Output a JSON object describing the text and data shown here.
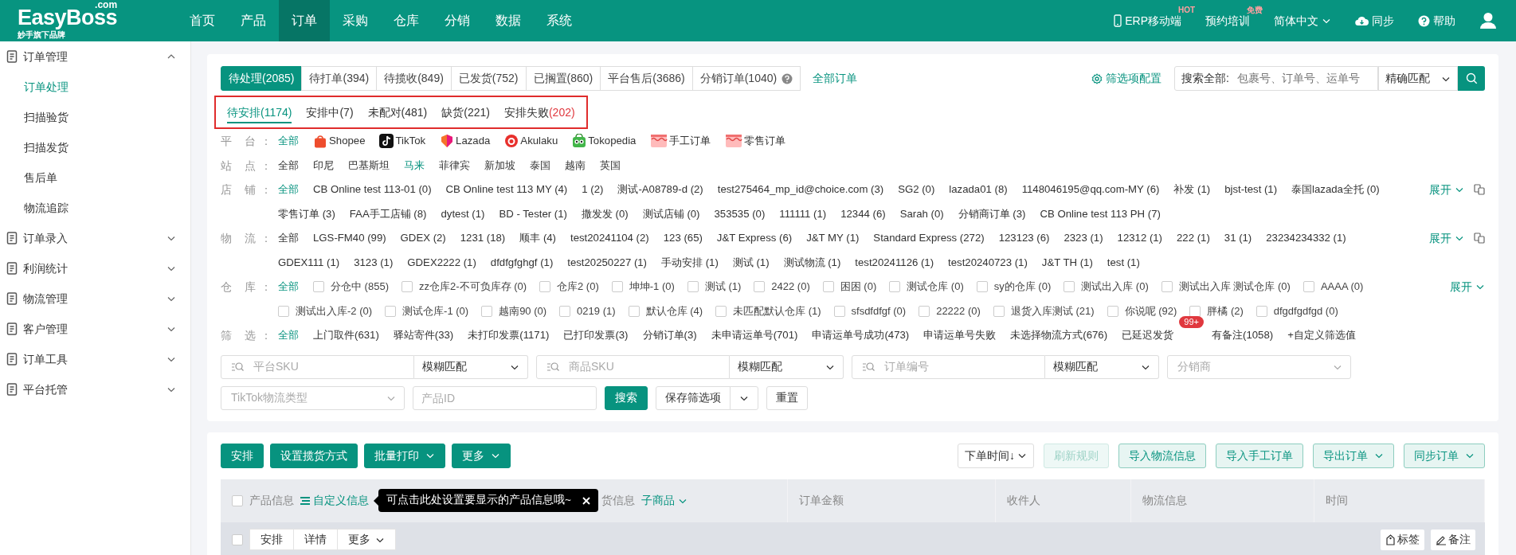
{
  "header": {
    "logo": "EasyBoss",
    "logo_suffix": ".com",
    "tagline": "妙手旗下品牌",
    "nav": [
      {
        "label": "首页",
        "selected": false
      },
      {
        "label": "产品",
        "selected": false
      },
      {
        "label": "订单",
        "selected": true
      },
      {
        "label": "采购",
        "selected": false
      },
      {
        "label": "仓库",
        "selected": false
      },
      {
        "label": "分销",
        "selected": false
      },
      {
        "label": "数据",
        "selected": false
      },
      {
        "label": "系统",
        "selected": false
      }
    ],
    "tools": [
      {
        "kind": "mobile",
        "label": "ERP移动端",
        "badge": "HOT"
      },
      {
        "kind": "plain",
        "label": "预约培训",
        "badge": "免费"
      },
      {
        "kind": "language",
        "label": "简体中文"
      },
      {
        "kind": "sync",
        "label": "同步"
      },
      {
        "kind": "help",
        "label": "帮助"
      },
      {
        "kind": "user"
      }
    ]
  },
  "sidebar": [
    {
      "label": "订单管理",
      "expanded": true,
      "children": [
        {
          "label": "订单处理",
          "selected": true
        },
        {
          "label": "扫描验货",
          "selected": false
        },
        {
          "label": "扫描发货",
          "selected": false
        },
        {
          "label": "售后单",
          "selected": false
        },
        {
          "label": "物流追踪",
          "selected": false
        }
      ]
    },
    {
      "label": "订单录入",
      "expanded": false
    },
    {
      "label": "利润统计",
      "expanded": false
    },
    {
      "label": "物流管理",
      "expanded": false
    },
    {
      "label": "客户管理",
      "expanded": false
    },
    {
      "label": "订单工具",
      "expanded": false
    },
    {
      "label": "平台托管",
      "expanded": false
    }
  ],
  "status_tabs": [
    {
      "label": "待处理(2085)",
      "selected": true,
      "help": false
    },
    {
      "label": "待打单(394)",
      "selected": false,
      "help": false
    },
    {
      "label": "待揽收(849)",
      "selected": false,
      "help": false
    },
    {
      "label": "已发货(752)",
      "selected": false,
      "help": false
    },
    {
      "label": "已搁置(860)",
      "selected": false,
      "help": false
    },
    {
      "label": "平台售后(3686)",
      "selected": false,
      "help": false
    },
    {
      "label": "分销订单(1040)",
      "selected": false,
      "help": true
    }
  ],
  "all_orders_link": "全部订单",
  "filter_config": "筛选项配置",
  "global_search": {
    "label": "搜索全部:",
    "placeholder": "包裹号、订单号、运单号",
    "match": "精确匹配"
  },
  "sub_tabs": [
    {
      "label": "待安排",
      "count": "(1174)",
      "selected": true,
      "alert": false
    },
    {
      "label": "安排中",
      "count": "(7)",
      "selected": false,
      "alert": false
    },
    {
      "label": "未配对",
      "count": "(481)",
      "selected": false,
      "alert": false
    },
    {
      "label": "缺货",
      "count": "(221)",
      "selected": false,
      "alert": false
    },
    {
      "label": "安排失败",
      "count": "(202)",
      "selected": false,
      "alert": true
    }
  ],
  "filters": [
    {
      "label": "平 台：",
      "items": [
        {
          "kind": "link",
          "label": "全部",
          "selected": true
        },
        {
          "kind": "platform",
          "label": "Shopee",
          "selected": false
        },
        {
          "kind": "platform",
          "label": "TikTok",
          "selected": false
        },
        {
          "kind": "platform",
          "label": "Lazada",
          "selected": false
        },
        {
          "kind": "platform",
          "label": "Akulaku",
          "selected": false
        },
        {
          "kind": "platform",
          "label": "Tokopedia",
          "selected": false
        },
        {
          "kind": "platform",
          "label": "手工订单",
          "selected": false
        },
        {
          "kind": "platform",
          "label": "零售订单",
          "selected": false
        }
      ]
    },
    {
      "label": "站 点：",
      "items": [
        {
          "kind": "link",
          "label": "全部",
          "selected": false
        },
        {
          "kind": "link",
          "label": "印尼",
          "selected": false
        },
        {
          "kind": "link",
          "label": "巴基斯坦",
          "selected": false
        },
        {
          "kind": "link",
          "label": "马来",
          "selected": true
        },
        {
          "kind": "link",
          "label": "菲律宾",
          "selected": false
        },
        {
          "kind": "link",
          "label": "新加坡",
          "selected": false
        },
        {
          "kind": "link",
          "label": "泰国",
          "selected": false
        },
        {
          "kind": "link",
          "label": "越南",
          "selected": false
        },
        {
          "kind": "link",
          "label": "英国",
          "selected": false
        }
      ]
    },
    {
      "label": "店 铺：",
      "expand": "展开",
      "copy_icon": true,
      "items": [
        {
          "kind": "link",
          "label": "全部",
          "selected": true
        },
        {
          "kind": "link",
          "label": "CB Online test 113-01 (0)",
          "selected": false
        },
        {
          "kind": "link",
          "label": "CB Online test 113 MY (4)",
          "selected": false
        },
        {
          "kind": "link",
          "label": "1 (2)",
          "selected": false
        },
        {
          "kind": "link",
          "label": "测试-A08789-d (2)",
          "selected": false
        },
        {
          "kind": "link",
          "label": "test275464_mp_id@choice.com (3)",
          "selected": false
        },
        {
          "kind": "link",
          "label": "SG2 (0)",
          "selected": false
        },
        {
          "kind": "link",
          "label": "lazada01 (8)",
          "selected": false
        },
        {
          "kind": "link",
          "label": "1148046195@qq.com-MY (6)",
          "selected": false
        },
        {
          "kind": "link",
          "label": "补发 (1)",
          "selected": false
        },
        {
          "kind": "link",
          "label": "bjst-test (1)",
          "selected": false
        },
        {
          "kind": "link",
          "label": "泰国lazada全托 (0)",
          "selected": false
        },
        {
          "kind": "link",
          "label": "零售订单 (3)",
          "selected": false
        },
        {
          "kind": "link",
          "label": "FAA手工店铺 (8)",
          "selected": false
        },
        {
          "kind": "link",
          "label": "dytest (1)",
          "selected": false
        },
        {
          "kind": "link",
          "label": "BD - Tester (1)",
          "selected": false
        },
        {
          "kind": "link",
          "label": "撒发发 (0)",
          "selected": false
        },
        {
          "kind": "link",
          "label": "测试店铺 (0)",
          "selected": false
        },
        {
          "kind": "link",
          "label": "353535 (0)",
          "selected": false
        },
        {
          "kind": "link",
          "label": "111111 (1)",
          "selected": false
        },
        {
          "kind": "link",
          "label": "12344 (6)",
          "selected": false
        },
        {
          "kind": "link",
          "label": "Sarah (0)",
          "selected": false
        },
        {
          "kind": "link",
          "label": "分销商订单 (3)",
          "selected": false
        },
        {
          "kind": "link",
          "label": "CB Online test 113 PH (7)",
          "selected": false
        }
      ]
    },
    {
      "label": "物 流：",
      "expand": "展开",
      "copy_icon": true,
      "items": [
        {
          "kind": "link",
          "label": "全部",
          "selected": false
        },
        {
          "kind": "link",
          "label": "LGS-FM40 (99)",
          "selected": false
        },
        {
          "kind": "link",
          "label": "GDEX (2)",
          "selected": false
        },
        {
          "kind": "link",
          "label": "1231 (18)",
          "selected": false
        },
        {
          "kind": "link",
          "label": "顺丰 (4)",
          "selected": false
        },
        {
          "kind": "link",
          "label": "test20241104 (2)",
          "selected": false
        },
        {
          "kind": "link",
          "label": "123 (65)",
          "selected": false
        },
        {
          "kind": "link",
          "label": "J&T Express (6)",
          "selected": false
        },
        {
          "kind": "link",
          "label": "J&T MY (1)",
          "selected": false
        },
        {
          "kind": "link",
          "label": "Standard Express (272)",
          "selected": false
        },
        {
          "kind": "link",
          "label": "123123 (6)",
          "selected": false
        },
        {
          "kind": "link",
          "label": "2323 (1)",
          "selected": false
        },
        {
          "kind": "link",
          "label": "12312 (1)",
          "selected": false
        },
        {
          "kind": "link",
          "label": "222 (1)",
          "selected": false
        },
        {
          "kind": "link",
          "label": "31 (1)",
          "selected": false
        },
        {
          "kind": "link",
          "label": "23234234332 (1)",
          "selected": false
        },
        {
          "kind": "link",
          "label": "GDEX111 (1)",
          "selected": false
        },
        {
          "kind": "link",
          "label": "3123 (1)",
          "selected": false
        },
        {
          "kind": "link",
          "label": "GDEX2222 (1)",
          "selected": false
        },
        {
          "kind": "link",
          "label": "dfdfgfghgf (1)",
          "selected": false
        },
        {
          "kind": "link",
          "label": "test20250227 (1)",
          "selected": false
        },
        {
          "kind": "link",
          "label": "手动安排 (1)",
          "selected": false
        },
        {
          "kind": "link",
          "label": "测试 (1)",
          "selected": false
        },
        {
          "kind": "link",
          "label": "测试物流 (1)",
          "selected": false
        },
        {
          "kind": "link",
          "label": "test20241126 (1)",
          "selected": false
        },
        {
          "kind": "link",
          "label": "test20240723 (1)",
          "selected": false
        },
        {
          "kind": "link",
          "label": "J&T TH (1)",
          "selected": false
        },
        {
          "kind": "link",
          "label": "test (1)",
          "selected": false
        }
      ]
    },
    {
      "label": "仓 库：",
      "expand": "展开",
      "copy_icon": false,
      "items": [
        {
          "kind": "link",
          "label": "全部",
          "selected": true
        },
        {
          "kind": "checkbox",
          "label": "分仓中 (855)",
          "checked": false
        },
        {
          "kind": "checkbox",
          "label": "zz仓库2-不可负库存 (0)",
          "checked": false
        },
        {
          "kind": "checkbox",
          "label": "仓库2 (0)",
          "checked": false
        },
        {
          "kind": "checkbox",
          "label": "坤坤-1 (0)",
          "checked": false
        },
        {
          "kind": "checkbox",
          "label": "测试 (1)",
          "checked": false
        },
        {
          "kind": "checkbox",
          "label": "2422 (0)",
          "checked": false
        },
        {
          "kind": "checkbox",
          "label": "困困 (0)",
          "checked": false
        },
        {
          "kind": "checkbox",
          "label": "测试仓库 (0)",
          "checked": false
        },
        {
          "kind": "checkbox",
          "label": "sy的仓库 (0)",
          "checked": false
        },
        {
          "kind": "checkbox",
          "label": "测试出入库 (0)",
          "checked": false
        },
        {
          "kind": "checkbox",
          "label": "测试出入库 测试仓库 (0)",
          "checked": false
        },
        {
          "kind": "checkbox",
          "label": "AAAA (0)",
          "checked": false
        },
        {
          "kind": "checkbox",
          "label": "测试出入库-2 (0)",
          "checked": false
        },
        {
          "kind": "checkbox",
          "label": "测试仓库-1 (0)",
          "checked": false
        },
        {
          "kind": "checkbox",
          "label": "越南90 (0)",
          "checked": false
        },
        {
          "kind": "checkbox",
          "label": "0219 (1)",
          "checked": false
        },
        {
          "kind": "checkbox",
          "label": "默认仓库 (4)",
          "checked": false
        },
        {
          "kind": "checkbox",
          "label": "未匹配默认仓库 (1)",
          "checked": false
        },
        {
          "kind": "checkbox",
          "label": "sfsdfdfgf (0)",
          "checked": false
        },
        {
          "kind": "checkbox",
          "label": "22222 (0)",
          "checked": false
        },
        {
          "kind": "checkbox",
          "label": "退货入库测试 (21)",
          "checked": false
        },
        {
          "kind": "checkbox",
          "label": "你说呢 (92)",
          "checked": false
        },
        {
          "kind": "checkbox",
          "label": "胖橘 (2)",
          "checked": false
        },
        {
          "kind": "checkbox",
          "label": "dfgdfgdfgd (0)",
          "checked": false
        }
      ]
    },
    {
      "label": "筛 选：",
      "items": [
        {
          "kind": "link",
          "label": "全部",
          "selected": true
        },
        {
          "kind": "link",
          "label": "上门取件(631)",
          "selected": false
        },
        {
          "kind": "link",
          "label": "驿站寄件(33)",
          "selected": false
        },
        {
          "kind": "link",
          "label": "未打印发票(1171)",
          "selected": false
        },
        {
          "kind": "link",
          "label": "已打印发票(3)",
          "selected": false
        },
        {
          "kind": "link",
          "label": "分销订单(3)",
          "selected": false
        },
        {
          "kind": "link",
          "label": "未申请运单号(701)",
          "selected": false
        },
        {
          "kind": "link",
          "label": "申请运单号成功(473)",
          "selected": false
        },
        {
          "kind": "link",
          "label": "申请运单号失败",
          "selected": false
        },
        {
          "kind": "link",
          "label": "未选择物流方式(676)",
          "selected": false
        },
        {
          "kind": "link",
          "label": "已延迟发货",
          "selected": false,
          "badge": "99+"
        },
        {
          "kind": "link",
          "label": "有备注(1058)",
          "selected": false
        },
        {
          "kind": "action",
          "label": "+自定义筛选值"
        }
      ]
    }
  ],
  "search_rows": [
    [
      {
        "kind": "input_match",
        "placeholder": "平台SKU",
        "match": "模糊匹配"
      },
      {
        "kind": "input_match",
        "placeholder": "商品SKU",
        "match": "模糊匹配"
      },
      {
        "kind": "input_match",
        "placeholder": "订单编号",
        "match": "模糊匹配"
      },
      {
        "kind": "select",
        "placeholder": "分销商"
      }
    ],
    [
      {
        "kind": "select",
        "placeholder": "TikTok物流类型"
      },
      {
        "kind": "input",
        "placeholder": "产品ID"
      },
      {
        "kind": "button",
        "label": "搜索"
      },
      {
        "kind": "split",
        "label": "保存筛选项"
      },
      {
        "kind": "outline",
        "label": "重置"
      }
    ]
  ],
  "actions_left": [
    {
      "label": "安排",
      "dropdown": false
    },
    {
      "label": "设置揽货方式",
      "dropdown": false
    },
    {
      "label": "批量打印",
      "dropdown": true
    },
    {
      "label": "更多",
      "dropdown": true
    }
  ],
  "sort": {
    "value": "下单时间↓"
  },
  "actions_right": [
    {
      "label": "刷新规则",
      "disabled": true,
      "dropdown": false
    },
    {
      "label": "导入物流信息",
      "disabled": false,
      "dropdown": false
    },
    {
      "label": "导入手工订单",
      "disabled": false,
      "dropdown": false
    },
    {
      "label": "导出订单",
      "disabled": false,
      "dropdown": true
    },
    {
      "label": "同步订单",
      "disabled": false,
      "dropdown": true
    }
  ],
  "product_header": {
    "checked": false,
    "label": "产品信息",
    "link": "自定义信息",
    "tooltip": "可点击此处设置要显示的产品信息哦~",
    "covered_label": "货信息",
    "sub_link": "子商品"
  },
  "columns": [
    {
      "label": "订单金额"
    },
    {
      "label": "收件人"
    },
    {
      "label": "物流信息"
    },
    {
      "label": "时间"
    }
  ],
  "row_checked": false,
  "row_actions": [
    {
      "label": "安排",
      "dropdown": false
    },
    {
      "label": "详情",
      "dropdown": false
    },
    {
      "label": "更多",
      "dropdown": true
    }
  ],
  "row_tools": [
    {
      "kind": "tag",
      "label": "标签"
    },
    {
      "kind": "note",
      "label": "备注"
    }
  ]
}
